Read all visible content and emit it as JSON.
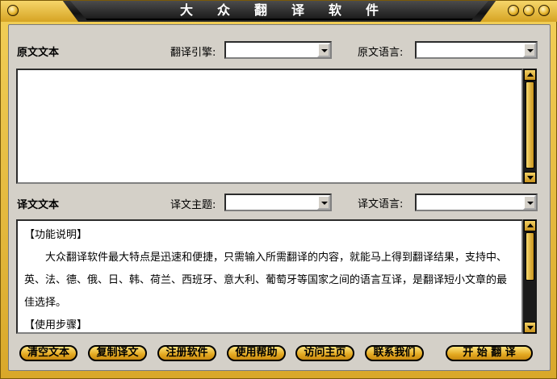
{
  "window": {
    "title": "大众翻译软件"
  },
  "source": {
    "section_label": "原文文本",
    "engine_label": "翻译引擎:",
    "engine_value": "",
    "lang_label": "原文语言:",
    "lang_value": "",
    "text": ""
  },
  "target": {
    "section_label": "译文文本",
    "topic_label": "译文主题:",
    "topic_value": "",
    "lang_label": "译文语言:",
    "lang_value": "",
    "paragraphs": [
      "【功能说明】",
      "　　大众翻译软件最大特点是迅速和便捷，只需输入所需翻译的内容，就能马上得到翻译结果，支持中、英、法、德、俄、日、韩、荷兰、西班牙、意大利、葡萄牙等国家之间的语言互译，是翻译短小文章的最佳选择。",
      "【使用步骤】"
    ]
  },
  "buttons": {
    "clear": "清空文本",
    "copy": "复制译文",
    "register": "注册软件",
    "help": "使用帮助",
    "home": "访问主页",
    "contact": "联系我们",
    "translate": "开 始 翻 译"
  },
  "colors": {
    "accent_gold": "#e3a820",
    "panel_gray": "#d4d0c8",
    "titlebar": "#1c1c1c"
  }
}
